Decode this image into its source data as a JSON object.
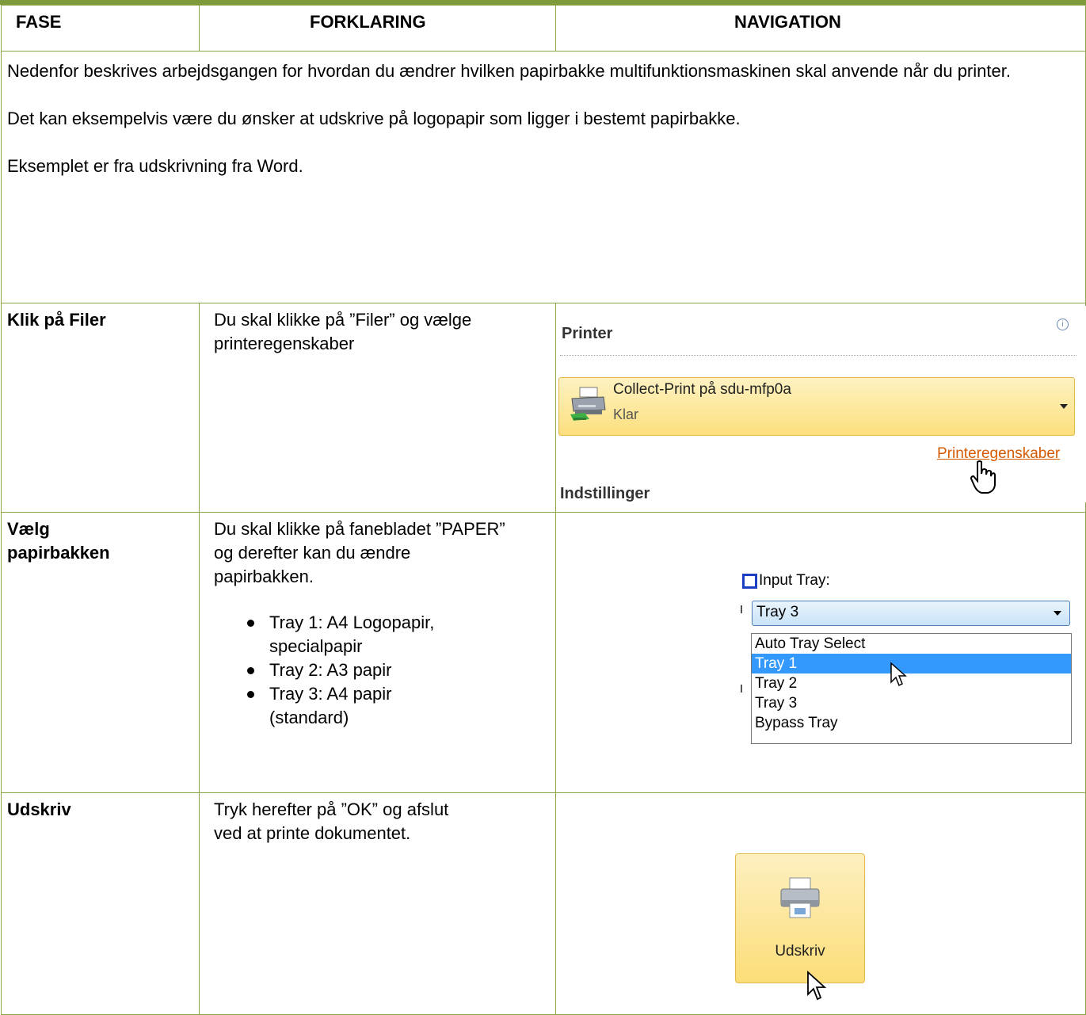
{
  "header": {
    "col1": "FASE",
    "col2": "FORKLARING",
    "col3": "NAVIGATION"
  },
  "intro": {
    "p1": "Nedenfor beskrives arbejdsgangen for hvordan du ændrer hvilken papirbakke multifunktionsmaskinen skal anvende når du printer.",
    "p2": "Det kan eksempelvis være du ønsker at udskrive på logopapir som ligger i bestemt papirbakke.",
    "p3": "Eksemplet er fra udskrivning fra Word."
  },
  "steps": [
    {
      "fase": "Klik på Filer",
      "forklaring": "Du skal klikke på ”Filer” og vælge printeregenskaber"
    },
    {
      "fase": "Vælg papirbakken",
      "forklaring": "Du skal klikke på fanebladet ”PAPER” og derefter kan du ændre papirbakken.",
      "bullets": [
        "Tray 1: A4 Logopapir, specialpapir",
        "Tray 2: A3 papir",
        "Tray 3: A4 papir (standard)"
      ]
    },
    {
      "fase": "Udskriv",
      "forklaring": "Tryk herefter på ”OK” og afslut ved at printe dokumentet."
    }
  ],
  "printer_panel": {
    "title": "Printer",
    "printer_name": "Collect-Print på sdu-mfp0a",
    "status": "Klar",
    "properties_link": "Printeregenskaber",
    "settings_title": "Indstillinger",
    "info_icon": "info-icon"
  },
  "tray_select": {
    "label": "Input Tray:",
    "selected": "Tray 3",
    "options": [
      "Auto Tray Select",
      "Tray 1",
      "Tray 2",
      "Tray 3",
      "Bypass Tray"
    ],
    "highlighted": "Tray 1"
  },
  "print_button": {
    "label": "Udskriv"
  },
  "colors": {
    "border": "#8aa548",
    "topbar": "#7f9a3a",
    "link": "#d65a00",
    "highlight": "#3399ff"
  }
}
